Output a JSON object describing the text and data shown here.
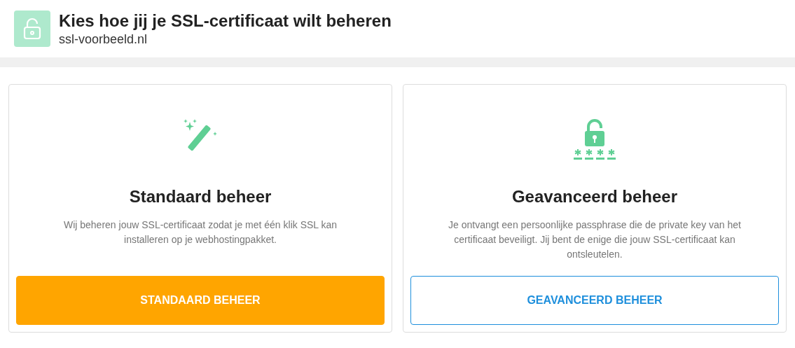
{
  "header": {
    "title": "Kies hoe jij je SSL-certificaat wilt beheren",
    "subtitle": "ssl-voorbeeld.nl"
  },
  "options": [
    {
      "kind": "wand",
      "title": "Standaard beheer",
      "description": "Wij beheren jouw SSL-certificaat zodat je met één klik SSL kan installeren op je webhostingpakket.",
      "button": {
        "label": "STANDAARD BEHEER",
        "kind": "primary"
      }
    },
    {
      "kind": "lock",
      "title": "Geavanceerd beheer",
      "description": "Je ontvangt een persoonlijke passphrase die de private key van het certificaat beveiligt. Jij bent de enige die jouw SSL-certificaat kan ontsleutelen.",
      "button": {
        "label": "GEAVANCEERD BEHEER",
        "kind": "outline"
      }
    }
  ]
}
